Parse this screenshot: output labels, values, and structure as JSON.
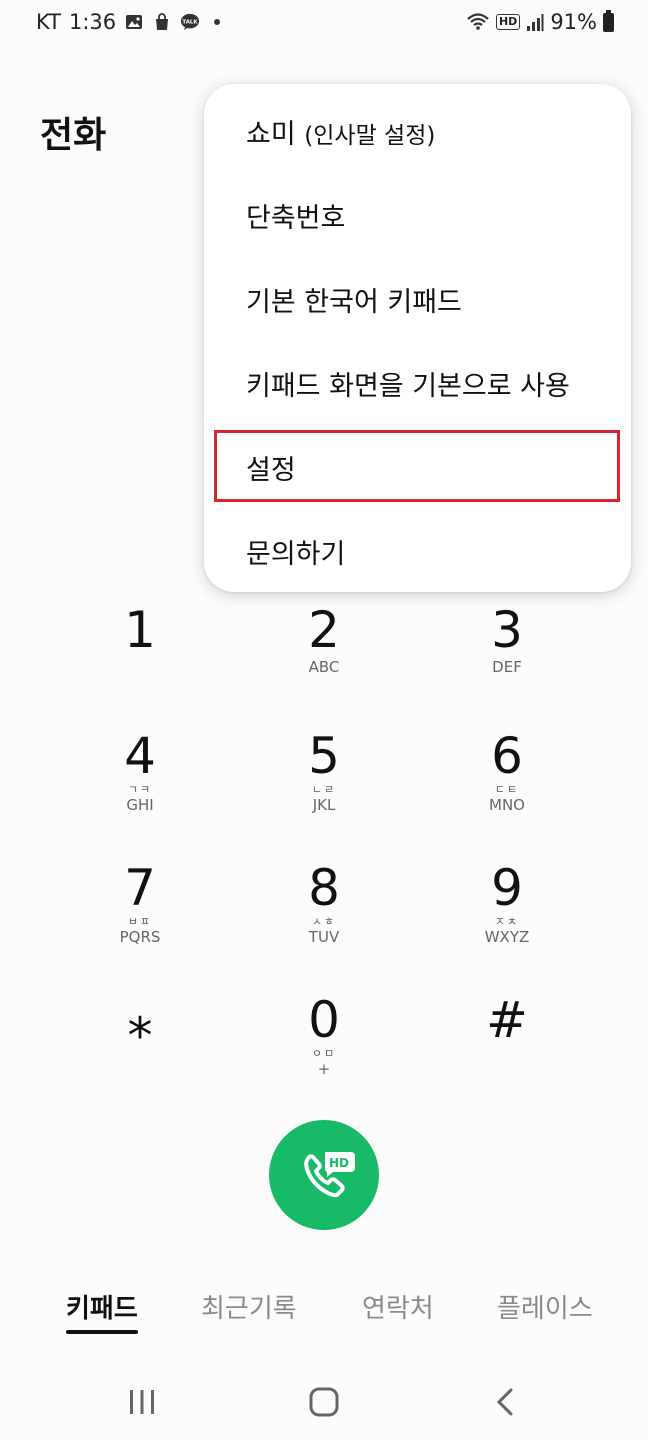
{
  "status_bar": {
    "carrier": "KT",
    "time": "1:36",
    "talk_badge": "TALK",
    "hd_label": "HD",
    "battery": "91%"
  },
  "page_title": "전화",
  "menu": {
    "items": [
      {
        "label": "쇼미",
        "sub": "(인사말 설정)"
      },
      {
        "label": "단축번호"
      },
      {
        "label": "기본 한국어 키패드"
      },
      {
        "label": "키패드 화면을 기본으로 사용"
      },
      {
        "label": "설정",
        "highlighted": true
      },
      {
        "label": "문의하기"
      }
    ],
    "highlight_color": "#d7262f"
  },
  "keypad": [
    {
      "digit": "1",
      "hangul": "",
      "letters": ""
    },
    {
      "digit": "2",
      "hangul": "",
      "letters": "ABC"
    },
    {
      "digit": "3",
      "hangul": "",
      "letters": "DEF"
    },
    {
      "digit": "4",
      "hangul": "ㄱㅋ",
      "letters": "GHI"
    },
    {
      "digit": "5",
      "hangul": "ㄴㄹ",
      "letters": "JKL"
    },
    {
      "digit": "6",
      "hangul": "ㄷㅌ",
      "letters": "MNO"
    },
    {
      "digit": "7",
      "hangul": "ㅂㅍ",
      "letters": "PQRS"
    },
    {
      "digit": "8",
      "hangul": "ㅅㅎ",
      "letters": "TUV"
    },
    {
      "digit": "9",
      "hangul": "ㅈㅊ",
      "letters": "WXYZ"
    },
    {
      "digit": "⁎",
      "hangul": "",
      "letters": ""
    },
    {
      "digit": "0",
      "hangul": "ㅇㅁ",
      "letters": "+"
    },
    {
      "digit": "#",
      "hangul": "",
      "letters": ""
    }
  ],
  "call_button": {
    "badge": "HD",
    "color": "#18b967"
  },
  "tabs": [
    {
      "label": "키패드",
      "active": true
    },
    {
      "label": "최근기록",
      "active": false
    },
    {
      "label": "연락처",
      "active": false
    },
    {
      "label": "플레이스",
      "active": false
    }
  ],
  "nav": {
    "recent_icon": "recent-apps-icon",
    "home_icon": "home-icon",
    "back_icon": "back-icon"
  }
}
